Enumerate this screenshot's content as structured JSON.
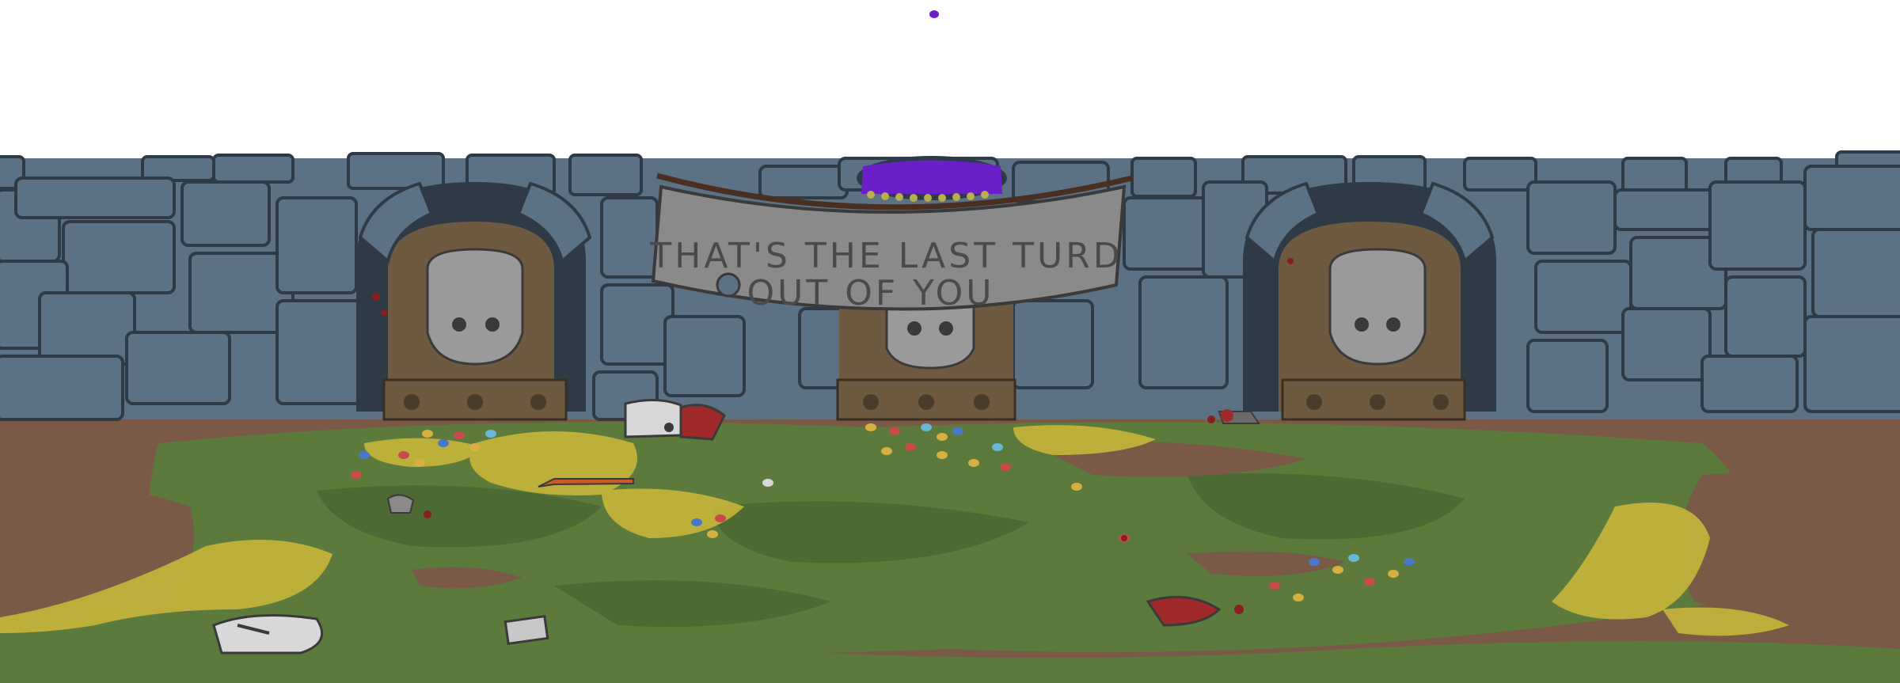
{
  "scene": {
    "banner": {
      "line1": "THAT'S THE LAST TURD",
      "line2": "OUT OF YOU"
    },
    "doors": [
      {
        "name": "left-skull-door"
      },
      {
        "name": "center-skull-door"
      },
      {
        "name": "right-skull-door"
      }
    ],
    "colors": {
      "sky": "#ffffff",
      "stone": "#5c7184",
      "stone_outline": "#2e3a45",
      "dirt": "#7a5a46",
      "grass": "#5b7a3c",
      "straw": "#c7b63a",
      "portal": "#6a1fc8",
      "banner": "#8a8a8a",
      "door_wood": "#6e5a40"
    }
  }
}
